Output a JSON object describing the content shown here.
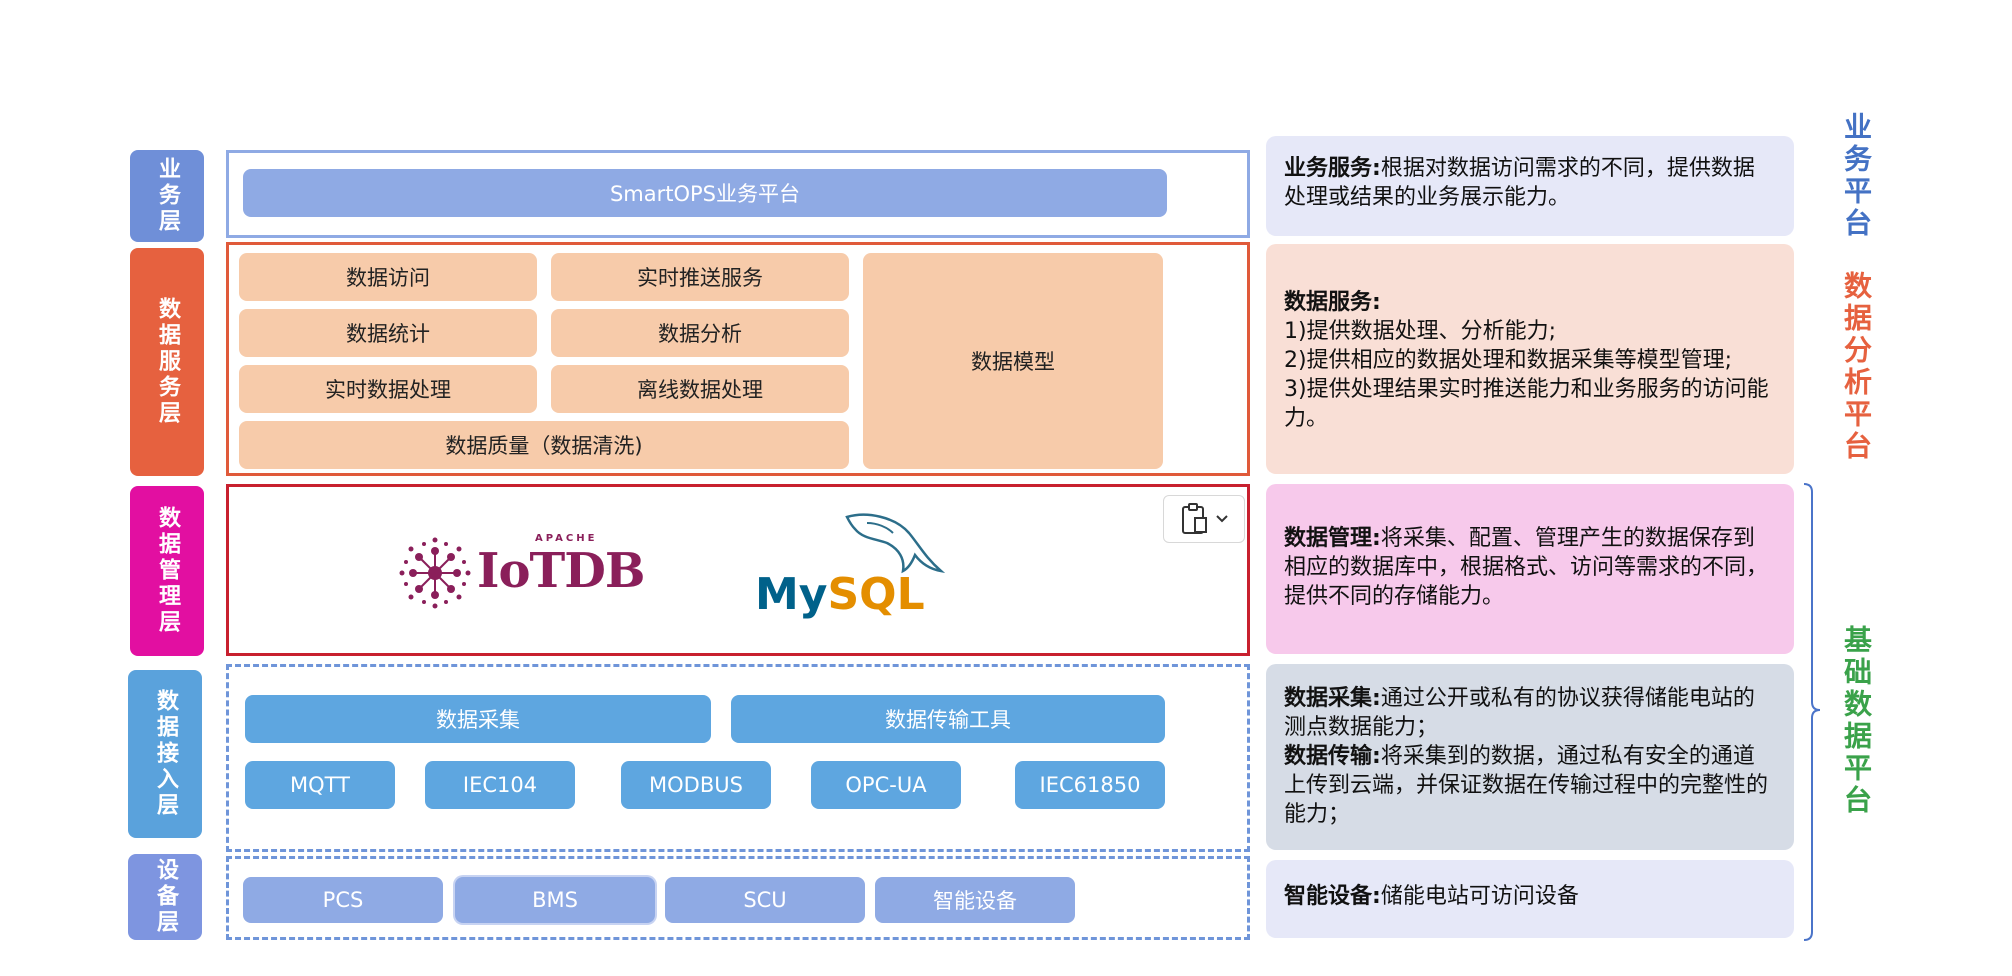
{
  "layers": [
    {
      "label": "业务层",
      "color": "#6f8fd8"
    },
    {
      "label": "数据服务层",
      "color": "#e6613f"
    },
    {
      "label": "数据管理层",
      "color": "#e20fa1"
    },
    {
      "label": "数据接入层",
      "color": "#5aa2dc"
    },
    {
      "label": "设备层",
      "color": "#7e95e0"
    }
  ],
  "business": {
    "platform": "SmartOPS业务平台"
  },
  "data_service": {
    "items": [
      "数据访问",
      "实时推送服务",
      "数据统计",
      "数据分析",
      "实时数据处理",
      "离线数据处理"
    ],
    "quality": "数据质量（数据清洗)",
    "model": "数据模型"
  },
  "data_management": {
    "logos": [
      {
        "name": "IoTDB",
        "text": "IoTD",
        "suffix": "B",
        "tag": "APACHE"
      },
      {
        "name": "MySQL",
        "text_a": "My",
        "text_b": "SQL"
      }
    ]
  },
  "data_access": {
    "collect": "数据采集",
    "transfer": "数据传输工具",
    "protocols": [
      "MQTT",
      "IEC104",
      "MODBUS",
      "OPC-UA",
      "IEC61850"
    ]
  },
  "devices": {
    "items": [
      "PCS",
      "BMS",
      "SCU",
      "智能设备"
    ]
  },
  "descriptions": {
    "business": {
      "title": "业务服务:",
      "text": "根据对数据访问需求的不同，提供数据处理或结果的业务展示能力。"
    },
    "service": {
      "title": "数据服务:",
      "lines": [
        "1)提供数据处理、分析能力;",
        "2)提供相应的数据处理和数据采集等模型管理;",
        "3)提供处理结果实时推送能力和业务服务的访问能力。"
      ]
    },
    "management": {
      "title": "数据管理:",
      "text": "将采集、配置、管理产生的数据保存到相应的数据库中，根据格式、访问等需求的不同，提供不同的存储能力。"
    },
    "collect": {
      "title": "数据采集:",
      "text": "通过公开或私有的协议获得储能电站的测点数据能力；"
    },
    "transfer": {
      "title": "数据传输:",
      "text": "将采集到的数据，通过私有安全的通道上传到云端，并保证数据在传输过程中的完整性的能力；"
    },
    "device": {
      "title": "智能设备:",
      "text": "储能电站可访问设备"
    }
  },
  "platforms": [
    {
      "label": "业务平台",
      "color": "#4472c4"
    },
    {
      "label": "数据分析平台",
      "color": "#e6613f"
    },
    {
      "label": "基础数据平台",
      "color": "#3aa24a"
    }
  ]
}
